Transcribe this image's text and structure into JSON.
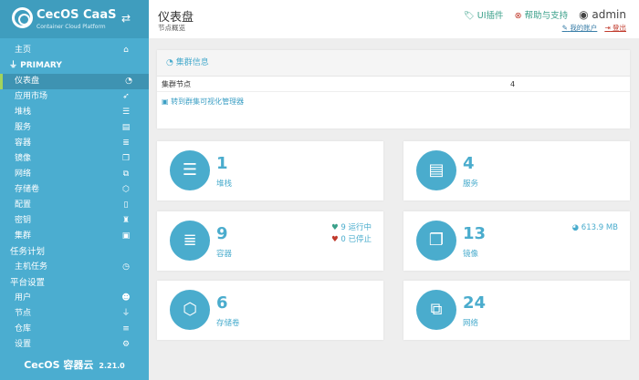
{
  "logo": {
    "title": "CecOS CaaS",
    "subtitle": "Container Cloud Platform"
  },
  "sidebar": {
    "items": [
      {
        "label": "主页",
        "icon": "⌂",
        "type": "item"
      },
      {
        "label": "PRIMARY",
        "icon": "",
        "type": "primary"
      },
      {
        "label": "仪表盘",
        "icon": "◔",
        "type": "active"
      },
      {
        "label": "应用市场",
        "icon": "➶",
        "type": "item"
      },
      {
        "label": "堆栈",
        "icon": "☰",
        "type": "item"
      },
      {
        "label": "服务",
        "icon": "▤",
        "type": "item"
      },
      {
        "label": "容器",
        "icon": "≣",
        "type": "item"
      },
      {
        "label": "镜像",
        "icon": "❐",
        "type": "item"
      },
      {
        "label": "网络",
        "icon": "⧉",
        "type": "item"
      },
      {
        "label": "存储卷",
        "icon": "⬡",
        "type": "item"
      },
      {
        "label": "配置",
        "icon": "▯",
        "type": "item"
      },
      {
        "label": "密钥",
        "icon": "♜",
        "type": "item"
      },
      {
        "label": "集群",
        "icon": "▣",
        "type": "item"
      },
      {
        "label": "任务计划",
        "icon": "",
        "type": "section"
      },
      {
        "label": "主机任务",
        "icon": "◷",
        "type": "item"
      },
      {
        "label": "平台设置",
        "icon": "",
        "type": "section"
      },
      {
        "label": "用户",
        "icon": "☻",
        "type": "item"
      },
      {
        "label": "节点",
        "icon": "⏚",
        "type": "item"
      },
      {
        "label": "仓库",
        "icon": "≡",
        "type": "item"
      },
      {
        "label": "设置",
        "icon": "⚙",
        "type": "item"
      }
    ],
    "footer": {
      "name": "CecOS 容器云",
      "version": "2.21.0"
    }
  },
  "header": {
    "title": "仪表盘",
    "subtitle": "节点概览",
    "plugins": "UI插件",
    "help": "帮助与支持",
    "user": "admin",
    "account": "我的账户",
    "logout": "登出"
  },
  "cluster": {
    "title": "集群信息",
    "row_label": "集群节点",
    "row_value": "4",
    "link": "转到群集可视化管理器"
  },
  "cards": [
    {
      "num": "1",
      "label": "堆栈",
      "icon": "☰"
    },
    {
      "num": "4",
      "label": "服务",
      "icon": "▤"
    },
    {
      "num": "9",
      "label": "容器",
      "icon": "≣",
      "running": "9 运行中",
      "stopped": "0 已停止"
    },
    {
      "num": "13",
      "label": "镜像",
      "icon": "❐",
      "size": "613.9 MB"
    },
    {
      "num": "6",
      "label": "存储卷",
      "icon": "⬡"
    },
    {
      "num": "24",
      "label": "网络",
      "icon": "⧉"
    }
  ]
}
